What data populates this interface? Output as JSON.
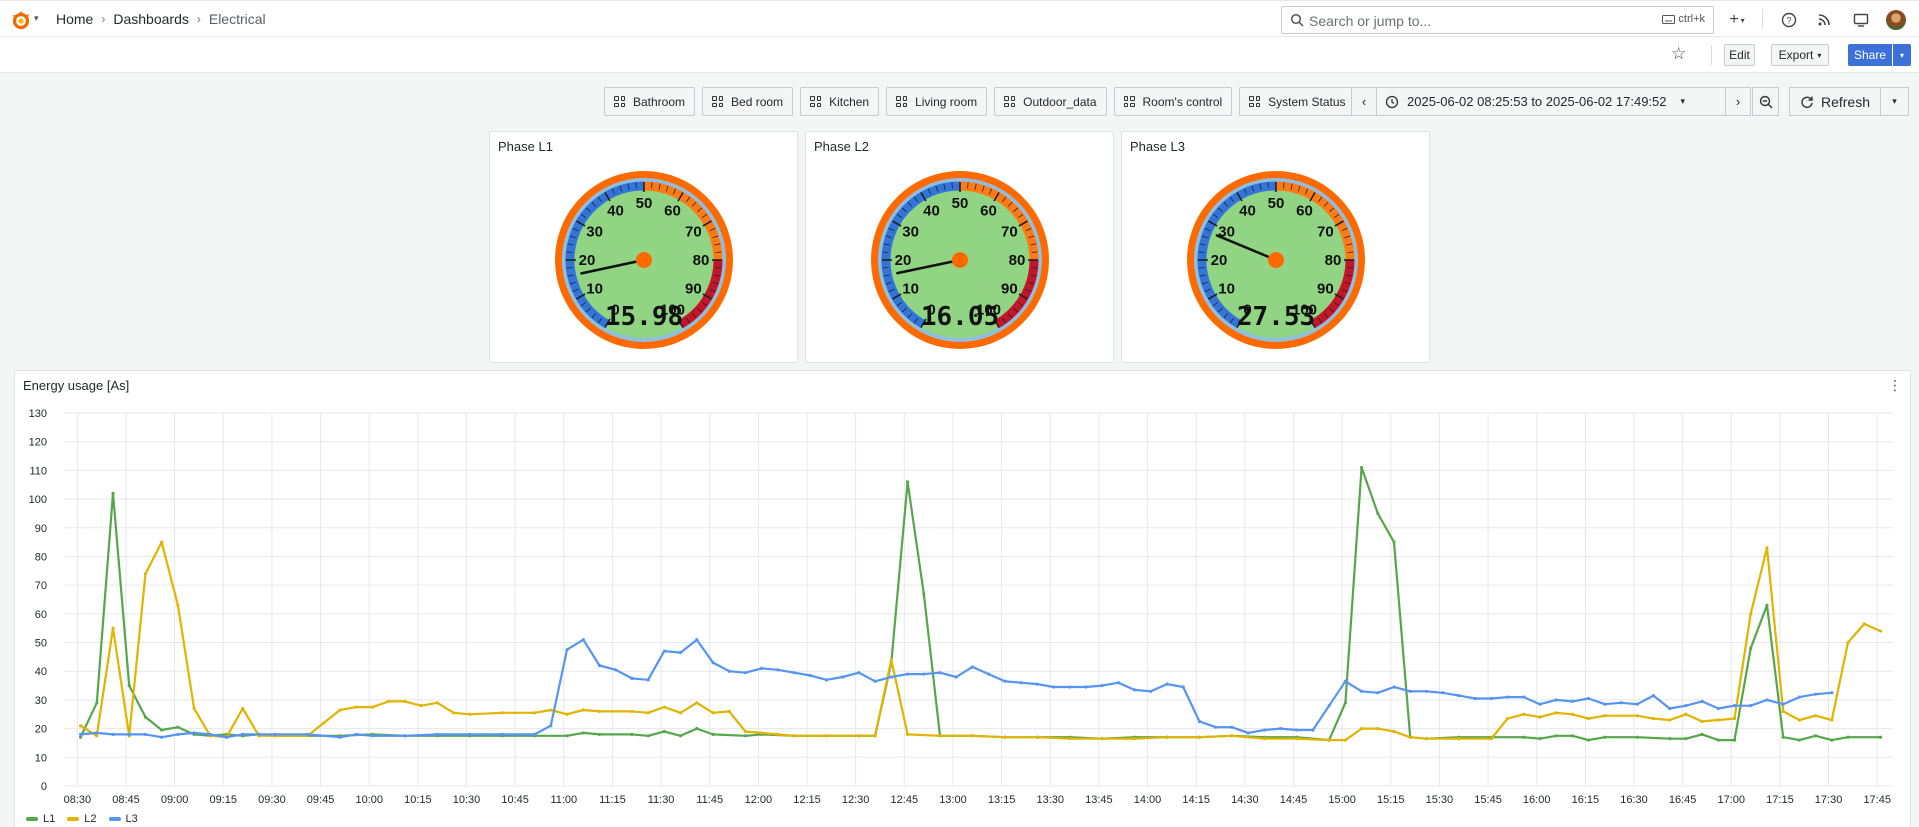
{
  "topbar": {
    "breadcrumbs": [
      "Home",
      "Dashboards",
      "Electrical"
    ],
    "search_placeholder": "Search or jump to...",
    "search_shortcut": "ctrl+k",
    "plus_label": "+"
  },
  "toolbar": {
    "edit_label": "Edit",
    "export_label": "Export",
    "share_label": "Share"
  },
  "links": [
    "Bathroom",
    "Bed room",
    "Kitchen",
    "Living room",
    "Outdoor_data",
    "Room's control",
    "System Status"
  ],
  "time_range": "2025-06-02 08:25:53 to 2025-06-02 17:49:52",
  "refresh_label": "Refresh",
  "gauges": [
    {
      "title": "Phase L1",
      "value": "15.98",
      "numeric": 15.98
    },
    {
      "title": "Phase L2",
      "value": "16.05",
      "numeric": 16.05
    },
    {
      "title": "Phase L3",
      "value": "27.53",
      "numeric": 27.53
    }
  ],
  "gauge_scale": {
    "min": 0,
    "max": 100,
    "labels": [
      "0",
      "10",
      "20",
      "30",
      "40",
      "50",
      "60",
      "70",
      "80",
      "90",
      "100"
    ]
  },
  "colors": {
    "l1": "#56a64b",
    "l2": "#e0b400",
    "l3": "#5794f2",
    "gauge_face": "#91d483",
    "gauge_rim": "#ff6a00",
    "gauge_low": "#3274d9",
    "gauge_mid": "#ff7a14",
    "gauge_high": "#c4162a"
  },
  "chart_panel_title": "Energy usage [As]",
  "chart_data": {
    "type": "line",
    "title": "Energy usage [As]",
    "ylim": [
      0,
      130
    ],
    "yticks": [
      "0",
      "10",
      "20",
      "30",
      "40",
      "50",
      "60",
      "70",
      "80",
      "90",
      "100",
      "110",
      "120",
      "130"
    ],
    "xticks": [
      "08:30",
      "08:45",
      "09:00",
      "09:15",
      "09:30",
      "09:45",
      "10:00",
      "10:15",
      "10:30",
      "10:45",
      "11:00",
      "11:15",
      "11:30",
      "11:45",
      "12:00",
      "12:15",
      "12:30",
      "12:45",
      "13:00",
      "13:15",
      "13:30",
      "13:45",
      "14:00",
      "14:15",
      "14:30",
      "14:45",
      "15:00",
      "15:15",
      "15:30",
      "15:45",
      "16:00",
      "16:15",
      "16:30",
      "16:45",
      "17:00",
      "17:15",
      "17:30",
      "17:45"
    ],
    "series": [
      {
        "name": "L1",
        "points": [
          [
            "08:31",
            17
          ],
          [
            "08:36",
            29
          ],
          [
            "08:41",
            102
          ],
          [
            "08:46",
            35
          ],
          [
            "08:51",
            24
          ],
          [
            "08:56",
            19.5
          ],
          [
            "09:01",
            20.5
          ],
          [
            "09:06",
            18
          ],
          [
            "09:11",
            17.5
          ],
          [
            "09:16",
            18
          ],
          [
            "09:21",
            17.5
          ],
          [
            "09:26",
            18
          ],
          [
            "09:31",
            17.5
          ],
          [
            "09:41",
            17.5
          ],
          [
            "09:51",
            17.5
          ],
          [
            "10:01",
            18
          ],
          [
            "10:11",
            17.5
          ],
          [
            "10:21",
            17.5
          ],
          [
            "10:31",
            17.5
          ],
          [
            "10:41",
            17.5
          ],
          [
            "10:51",
            17.5
          ],
          [
            "11:01",
            17.5
          ],
          [
            "11:06",
            18.5
          ],
          [
            "11:11",
            18
          ],
          [
            "11:21",
            18
          ],
          [
            "11:26",
            17.5
          ],
          [
            "11:31",
            19
          ],
          [
            "11:36",
            17.5
          ],
          [
            "11:41",
            20
          ],
          [
            "11:46",
            18
          ],
          [
            "11:56",
            17.5
          ],
          [
            "12:01",
            18
          ],
          [
            "12:11",
            17.5
          ],
          [
            "12:21",
            17.5
          ],
          [
            "12:31",
            17.5
          ],
          [
            "12:36",
            17.5
          ],
          [
            "12:41",
            43
          ],
          [
            "12:46",
            106
          ],
          [
            "12:51",
            67
          ],
          [
            "12:56",
            17.5
          ],
          [
            "13:06",
            17.5
          ],
          [
            "13:16",
            17
          ],
          [
            "13:26",
            17
          ],
          [
            "13:36",
            17
          ],
          [
            "13:46",
            16.5
          ],
          [
            "13:56",
            17
          ],
          [
            "14:06",
            17
          ],
          [
            "14:16",
            17
          ],
          [
            "14:26",
            17.5
          ],
          [
            "14:36",
            17
          ],
          [
            "14:46",
            17
          ],
          [
            "14:56",
            16
          ],
          [
            "15:01",
            29
          ],
          [
            "15:06",
            111
          ],
          [
            "15:11",
            95
          ],
          [
            "15:16",
            85
          ],
          [
            "15:21",
            17
          ],
          [
            "15:26",
            16.5
          ],
          [
            "15:36",
            17
          ],
          [
            "15:46",
            17
          ],
          [
            "15:56",
            17
          ],
          [
            "16:01",
            16.5
          ],
          [
            "16:06",
            17.5
          ],
          [
            "16:11",
            17.5
          ],
          [
            "16:16",
            16
          ],
          [
            "16:21",
            17
          ],
          [
            "16:31",
            17
          ],
          [
            "16:41",
            16.5
          ],
          [
            "16:46",
            16.5
          ],
          [
            "16:51",
            18
          ],
          [
            "16:56",
            16
          ],
          [
            "17:01",
            16
          ],
          [
            "17:06",
            48
          ],
          [
            "17:11",
            63
          ],
          [
            "17:16",
            17
          ],
          [
            "17:21",
            16
          ],
          [
            "17:26",
            17.5
          ],
          [
            "17:31",
            16
          ],
          [
            "17:36",
            17
          ],
          [
            "17:46",
            17
          ]
        ]
      },
      {
        "name": "L2",
        "points": [
          [
            "08:31",
            21
          ],
          [
            "08:36",
            17.5
          ],
          [
            "08:41",
            55
          ],
          [
            "08:46",
            17.5
          ],
          [
            "08:51",
            74
          ],
          [
            "08:56",
            85
          ],
          [
            "09:01",
            63
          ],
          [
            "09:06",
            27
          ],
          [
            "09:11",
            17.5
          ],
          [
            "09:16",
            17
          ],
          [
            "09:21",
            27
          ],
          [
            "09:26",
            17.5
          ],
          [
            "09:31",
            17.5
          ],
          [
            "09:41",
            17.5
          ],
          [
            "09:46",
            22
          ],
          [
            "09:51",
            26.5
          ],
          [
            "09:56",
            27.5
          ],
          [
            "10:01",
            27.5
          ],
          [
            "10:06",
            29.5
          ],
          [
            "10:11",
            29.5
          ],
          [
            "10:16",
            28
          ],
          [
            "10:21",
            29
          ],
          [
            "10:26",
            25.5
          ],
          [
            "10:31",
            25
          ],
          [
            "10:41",
            25.5
          ],
          [
            "10:51",
            25.5
          ],
          [
            "10:56",
            26.5
          ],
          [
            "11:01",
            25
          ],
          [
            "11:06",
            26.5
          ],
          [
            "11:11",
            26
          ],
          [
            "11:21",
            26
          ],
          [
            "11:26",
            25.5
          ],
          [
            "11:31",
            27.5
          ],
          [
            "11:36",
            25.5
          ],
          [
            "11:41",
            29
          ],
          [
            "11:46",
            25.5
          ],
          [
            "11:51",
            26
          ],
          [
            "11:56",
            19
          ],
          [
            "12:01",
            18.5
          ],
          [
            "12:06",
            18
          ],
          [
            "12:11",
            17.5
          ],
          [
            "12:21",
            17.5
          ],
          [
            "12:31",
            17.5
          ],
          [
            "12:36",
            17.5
          ],
          [
            "12:41",
            44
          ],
          [
            "12:46",
            18
          ],
          [
            "12:56",
            17.5
          ],
          [
            "13:06",
            17.5
          ],
          [
            "13:16",
            17
          ],
          [
            "13:26",
            17
          ],
          [
            "13:36",
            16.5
          ],
          [
            "13:46",
            16.5
          ],
          [
            "13:56",
            16.5
          ],
          [
            "14:06",
            17
          ],
          [
            "14:16",
            17
          ],
          [
            "14:26",
            17.5
          ],
          [
            "14:36",
            16.5
          ],
          [
            "14:46",
            16.5
          ],
          [
            "14:56",
            16
          ],
          [
            "15:01",
            16
          ],
          [
            "15:06",
            20
          ],
          [
            "15:11",
            20
          ],
          [
            "15:16",
            19
          ],
          [
            "15:21",
            17
          ],
          [
            "15:26",
            16.5
          ],
          [
            "15:36",
            16.5
          ],
          [
            "15:46",
            16.5
          ],
          [
            "15:51",
            23.5
          ],
          [
            "15:56",
            25
          ],
          [
            "16:01",
            24
          ],
          [
            "16:06",
            25.5
          ],
          [
            "16:11",
            25
          ],
          [
            "16:16",
            23.5
          ],
          [
            "16:21",
            24.5
          ],
          [
            "16:31",
            24.5
          ],
          [
            "16:36",
            23.5
          ],
          [
            "16:41",
            23
          ],
          [
            "16:46",
            25
          ],
          [
            "16:51",
            22.5
          ],
          [
            "16:56",
            23
          ],
          [
            "17:01",
            23.5
          ],
          [
            "17:06",
            60
          ],
          [
            "17:11",
            83
          ],
          [
            "17:16",
            26
          ],
          [
            "17:21",
            23
          ],
          [
            "17:26",
            24.5
          ],
          [
            "17:31",
            23
          ],
          [
            "17:36",
            50
          ],
          [
            "17:41",
            56.5
          ],
          [
            "17:46",
            54
          ]
        ]
      },
      {
        "name": "L3",
        "points": [
          [
            "08:31",
            18
          ],
          [
            "08:36",
            18.5
          ],
          [
            "08:41",
            18
          ],
          [
            "08:46",
            18
          ],
          [
            "08:51",
            18
          ],
          [
            "08:56",
            17
          ],
          [
            "09:01",
            18
          ],
          [
            "09:06",
            18.5
          ],
          [
            "09:11",
            18
          ],
          [
            "09:16",
            17
          ],
          [
            "09:21",
            18
          ],
          [
            "09:31",
            18
          ],
          [
            "09:41",
            18
          ],
          [
            "09:51",
            17
          ],
          [
            "09:56",
            18
          ],
          [
            "10:01",
            17.5
          ],
          [
            "10:11",
            17.5
          ],
          [
            "10:21",
            18
          ],
          [
            "10:31",
            18
          ],
          [
            "10:41",
            18
          ],
          [
            "10:51",
            18
          ],
          [
            "10:56",
            21
          ],
          [
            "11:01",
            47.5
          ],
          [
            "11:06",
            51
          ],
          [
            "11:11",
            42
          ],
          [
            "11:16",
            40.5
          ],
          [
            "11:21",
            37.5
          ],
          [
            "11:26",
            37
          ],
          [
            "11:31",
            47
          ],
          [
            "11:36",
            46.5
          ],
          [
            "11:41",
            51
          ],
          [
            "11:46",
            43
          ],
          [
            "11:51",
            40
          ],
          [
            "11:56",
            39.5
          ],
          [
            "12:01",
            41
          ],
          [
            "12:06",
            40.5
          ],
          [
            "12:11",
            39.5
          ],
          [
            "12:16",
            38.5
          ],
          [
            "12:21",
            37
          ],
          [
            "12:26",
            38
          ],
          [
            "12:31",
            39.5
          ],
          [
            "12:36",
            36.5
          ],
          [
            "12:41",
            38
          ],
          [
            "12:46",
            39
          ],
          [
            "12:51",
            39
          ],
          [
            "12:56",
            39.5
          ],
          [
            "13:01",
            38
          ],
          [
            "13:06",
            41.5
          ],
          [
            "13:11",
            39
          ],
          [
            "13:16",
            36.5
          ],
          [
            "13:21",
            36
          ],
          [
            "13:26",
            35.5
          ],
          [
            "13:31",
            34.5
          ],
          [
            "13:36",
            34.5
          ],
          [
            "13:41",
            34.5
          ],
          [
            "13:46",
            35
          ],
          [
            "13:51",
            36
          ],
          [
            "13:56",
            33.5
          ],
          [
            "14:01",
            33
          ],
          [
            "14:06",
            35.5
          ],
          [
            "14:11",
            34.5
          ],
          [
            "14:16",
            22.5
          ],
          [
            "14:21",
            20.5
          ],
          [
            "14:26",
            20.5
          ],
          [
            "14:31",
            18.5
          ],
          [
            "14:36",
            19.5
          ],
          [
            "14:41",
            20
          ],
          [
            "14:46",
            19.5
          ],
          [
            "14:51",
            19.5
          ],
          [
            "14:56",
            28
          ],
          [
            "15:01",
            36.5
          ],
          [
            "15:06",
            33
          ],
          [
            "15:11",
            32.5
          ],
          [
            "15:16",
            34.5
          ],
          [
            "15:21",
            33
          ],
          [
            "15:26",
            33
          ],
          [
            "15:31",
            32.5
          ],
          [
            "15:36",
            31.5
          ],
          [
            "15:41",
            30.5
          ],
          [
            "15:46",
            30.5
          ],
          [
            "15:51",
            31
          ],
          [
            "15:56",
            31
          ],
          [
            "16:01",
            28.5
          ],
          [
            "16:06",
            30
          ],
          [
            "16:11",
            29.5
          ],
          [
            "16:16",
            30.5
          ],
          [
            "16:21",
            28.5
          ],
          [
            "16:26",
            29
          ],
          [
            "16:31",
            28.5
          ],
          [
            "16:36",
            31.5
          ],
          [
            "16:41",
            27
          ],
          [
            "16:46",
            28
          ],
          [
            "16:51",
            29.5
          ],
          [
            "16:56",
            27
          ],
          [
            "17:01",
            28
          ],
          [
            "17:06",
            28
          ],
          [
            "17:11",
            30
          ],
          [
            "17:16",
            28.5
          ],
          [
            "17:21",
            31
          ],
          [
            "17:26",
            32
          ],
          [
            "17:31",
            32.5
          ]
        ]
      }
    ]
  }
}
